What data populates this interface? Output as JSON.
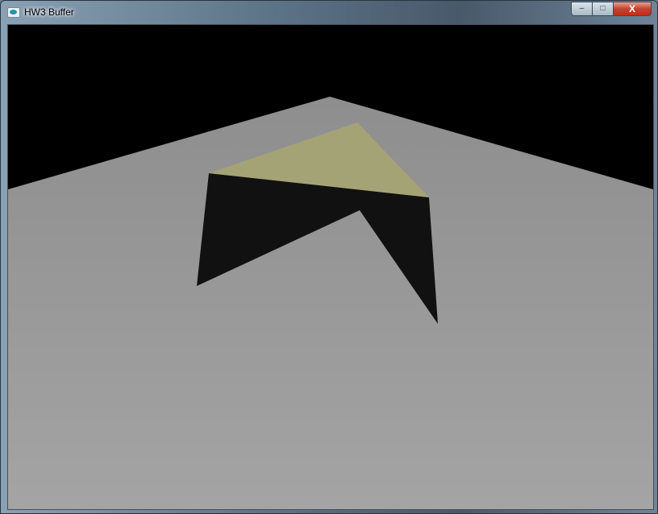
{
  "window": {
    "title": "HW3 Buffer",
    "icon": "app-window-icon",
    "controls": {
      "minimize": "–",
      "maximize": "□",
      "close": "X"
    }
  },
  "scene": {
    "colors": {
      "background": "#000000",
      "floor_top": "#8e8e8e",
      "floor_bottom": "#a4a4a4",
      "top_face": "#a3a375",
      "shadow_face": "#111111"
    }
  }
}
